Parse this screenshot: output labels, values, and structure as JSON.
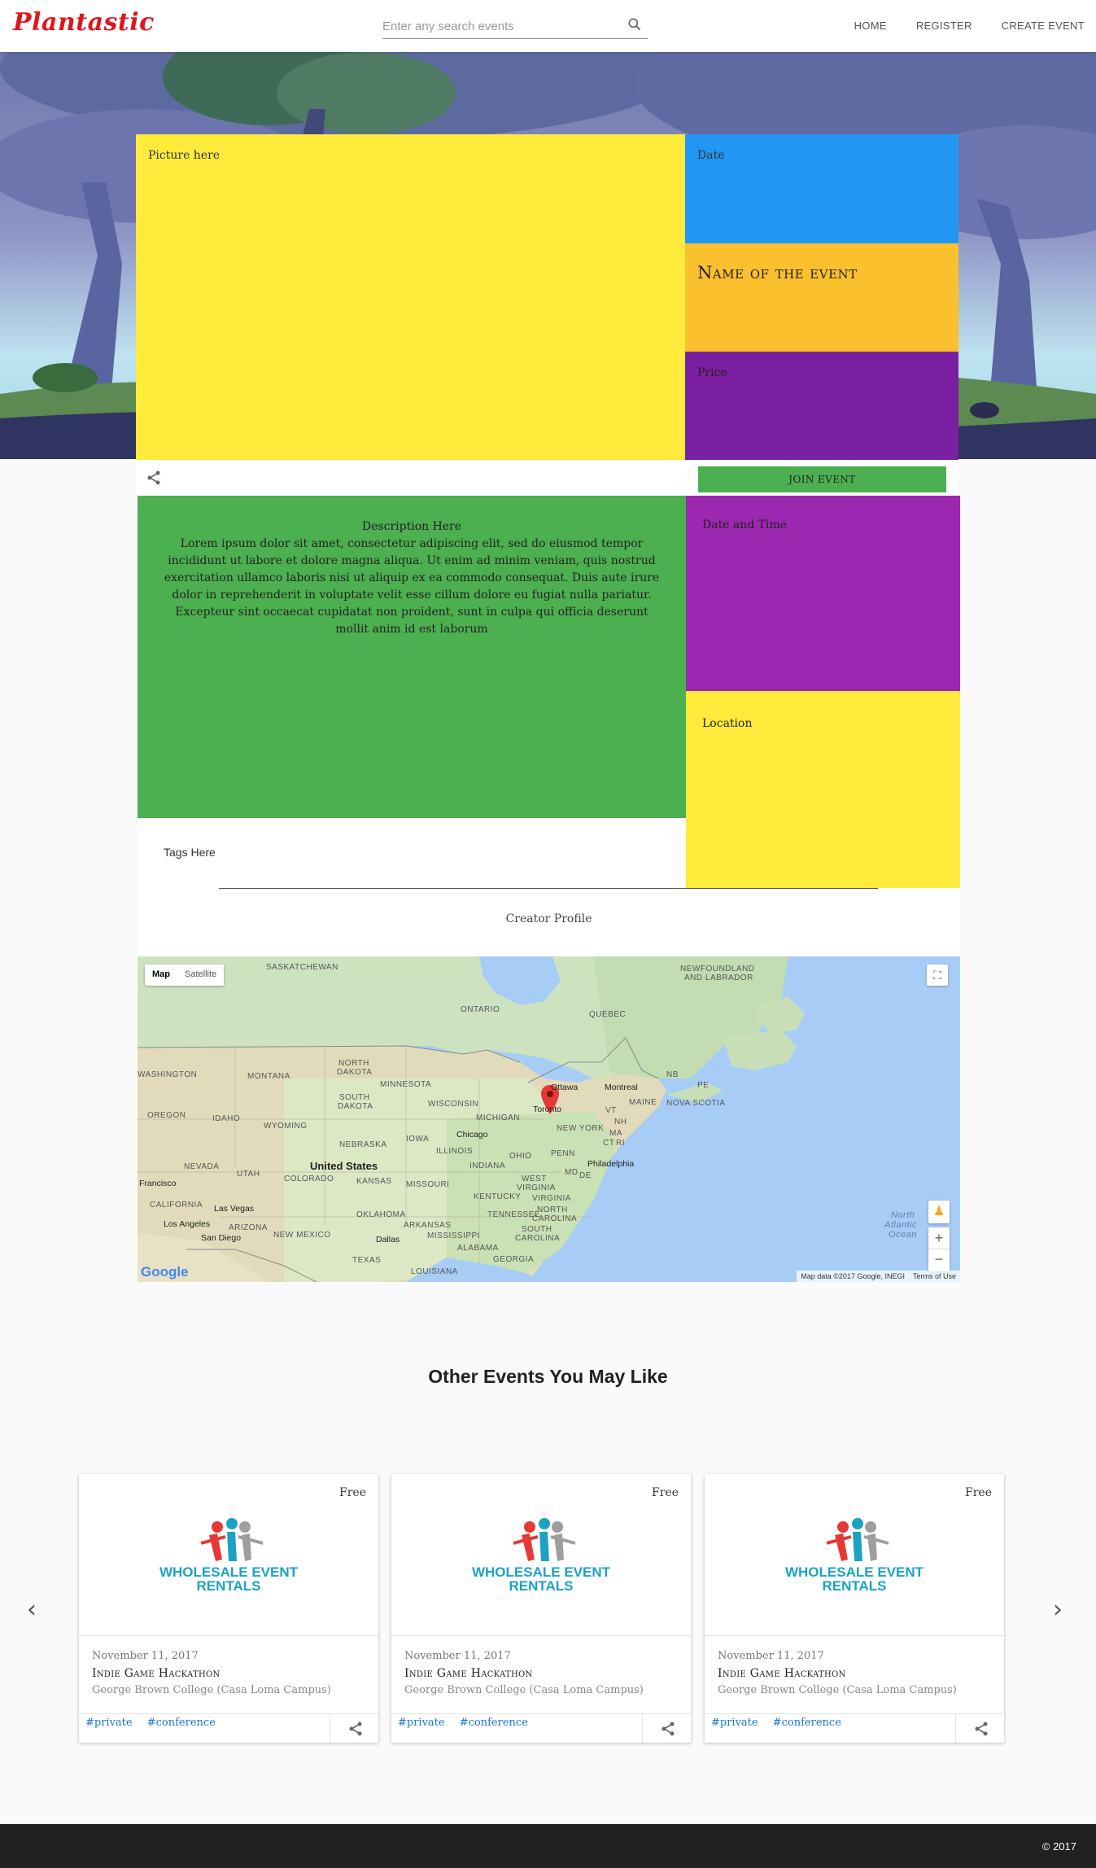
{
  "header": {
    "brand": "Plantastic",
    "search_placeholder": "Enter any search events",
    "nav": [
      "HOME",
      "REGISTER",
      "CREATE EVENT"
    ]
  },
  "event": {
    "picture_label": "Picture here",
    "date_label": "Date",
    "name_label": "Name of the event",
    "price_label": "Price",
    "join_label": "JOIN EVENT",
    "description_heading": "Description Here",
    "description_body": "Lorem ipsum dolor sit amet, consectetur adipiscing elit, sed do eiusmod tempor incididunt ut labore et dolore magna aliqua. Ut enim ad minim veniam, quis nostrud exercitation ullamco laboris nisi ut aliquip ex ea commodo consequat. Duis aute irure dolor in reprehenderit in voluptate velit esse cillum dolore eu fugiat nulla pariatur. Excepteur sint occaecat cupidatat non proident, sunt in culpa qui officia deserunt mollit anim id est laborum",
    "datetime_label": "Date and Time",
    "location_label": "Location",
    "tags_label": "Tags Here",
    "creator_label": "Creator Profile"
  },
  "map": {
    "toggle": [
      "Map",
      "Satellite"
    ],
    "footer_data": "Map data ©2017 Google, INEGI",
    "footer_terms": "Terms of Use",
    "logo": "Google",
    "labels": {
      "saskatchewan": "SASKATCHEWAN",
      "newfoundland": "NEWFOUNDLAND",
      "labrador": "AND LABRADOR",
      "ontario": "ONTARIO",
      "quebec": "QUEBEC",
      "washington": "WASHINGTON",
      "montana": "MONTANA",
      "north_dakota": "NORTH",
      "north_dakota2": "DAKOTA",
      "minnesota": "MINNESOTA",
      "ottawa": "Ottawa",
      "montreal": "Montreal",
      "nb": "NB",
      "pe": "PE",
      "oregon": "OREGON",
      "idaho": "IDAHO",
      "south_dakota": "SOUTH",
      "south_dakota2": "DAKOTA",
      "wisconsin": "WISCONSIN",
      "toronto": "Toronto",
      "vt": "VT",
      "maine": "MAINE",
      "nova_scotia": "NOVA SCOTIA",
      "wyoming": "WYOMING",
      "michigan": "MICHIGAN",
      "new_york": "NEW YORK",
      "nh": "NH",
      "chicago": "Chicago",
      "iowa": "IOWA",
      "nebraska": "NEBRASKA",
      "ma": "MA",
      "ct": "CT",
      "ri": "RI",
      "nevada": "NEVADA",
      "united_states": "United States",
      "illinois": "ILLINOIS",
      "ohio": "OHIO",
      "penn": "PENN",
      "utah": "UTAH",
      "colorado": "COLORADO",
      "indiana": "INDIANA",
      "philadelphia": "Philadelphia",
      "san_francisco": "Francisco",
      "kansas": "KANSAS",
      "missouri": "MISSOURI",
      "west": "WEST",
      "virginia1": "VIRGINIA",
      "md": "MD",
      "de": "DE",
      "california": "CALIFORNIA",
      "las_vegas": "Las Vegas",
      "kentucky": "KENTUCKY",
      "virginia2": "VIRGINIA",
      "oklahoma": "OKLAHOMA",
      "tennessee": "TENNESSEE",
      "north_carolina": "NORTH",
      "north_carolina2": "CAROLINA",
      "los_angeles": "Los Angeles",
      "arizona": "ARIZONA",
      "arkansas": "ARKANSAS",
      "new_mexico": "NEW MEXICO",
      "san_diego": "San Diego",
      "mississippi": "MISSISSIPPI",
      "south_carolina": "SOUTH",
      "south_carolina2": "CAROLINA",
      "dallas": "Dallas",
      "alabama": "ALABAMA",
      "georgia": "GEORGIA",
      "texas": "TEXAS",
      "louisiana": "LOUISIANA",
      "north_atlantic": "North",
      "north_atlantic2": "Atlantic",
      "north_atlantic3": "Ocean"
    }
  },
  "other": {
    "title": "Other Events You May Like",
    "cards": [
      {
        "price": "Free",
        "logo_line1": "WHOLESALE EVENT",
        "logo_line2": "RENTALS",
        "date": "November 11, 2017",
        "title": "Indie Game Hackathon",
        "venue": "George Brown College (Casa Loma Campus)",
        "tags": [
          "#private",
          "#conference"
        ]
      },
      {
        "price": "Free",
        "logo_line1": "WHOLESALE EVENT",
        "logo_line2": "RENTALS",
        "date": "November 11, 2017",
        "title": "Indie Game Hackathon",
        "venue": "George Brown College (Casa Loma Campus)",
        "tags": [
          "#private",
          "#conference"
        ]
      },
      {
        "price": "Free",
        "logo_line1": "WHOLESALE EVENT",
        "logo_line2": "RENTALS",
        "date": "November 11, 2017",
        "title": "Indie Game Hackathon",
        "venue": "George Brown College (Casa Loma Campus)",
        "tags": [
          "#private",
          "#conference"
        ]
      }
    ]
  },
  "footer": {
    "copyright": "© 2017"
  },
  "colors": {
    "brand": "#e0161d",
    "yellow": "#ffeb3b",
    "blue": "#2196f3",
    "amber": "#fbc02d",
    "purple": "#7b1fa2",
    "green": "#4caf50",
    "tag_blue": "#1976d2",
    "footer": "#212121"
  }
}
